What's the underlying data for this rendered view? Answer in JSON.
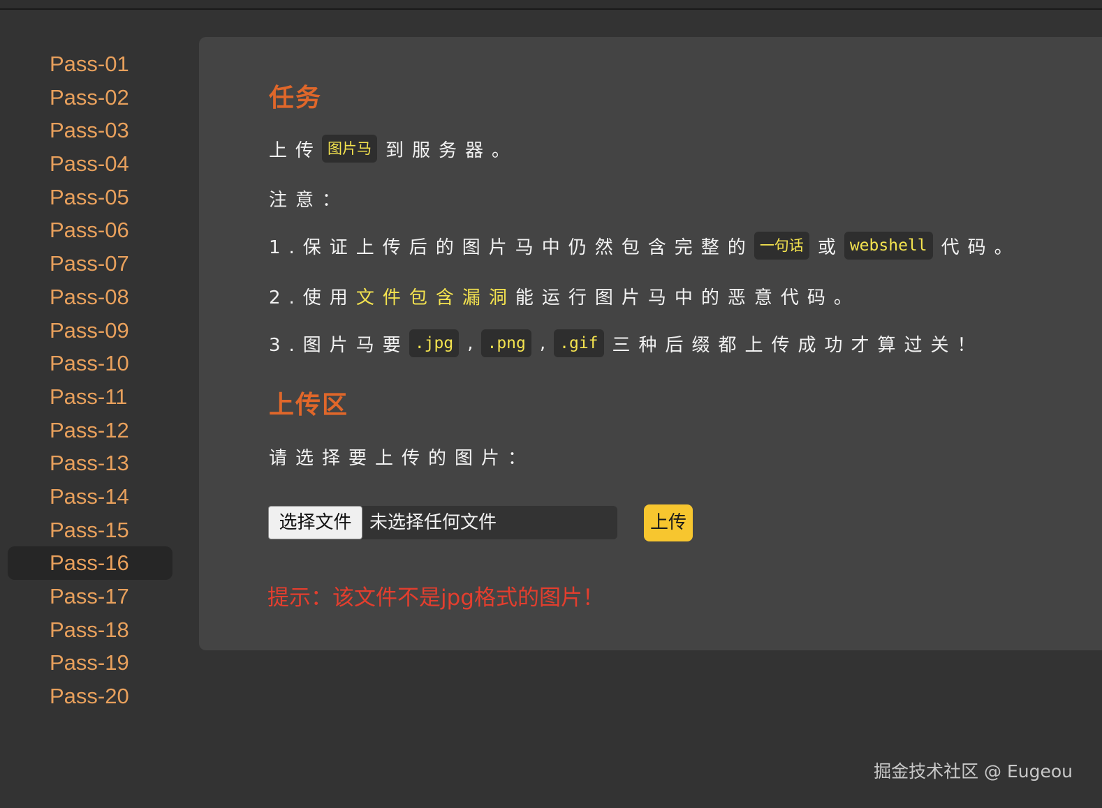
{
  "sidebar": {
    "items": [
      {
        "label": "Pass-01"
      },
      {
        "label": "Pass-02"
      },
      {
        "label": "Pass-03"
      },
      {
        "label": "Pass-04"
      },
      {
        "label": "Pass-05"
      },
      {
        "label": "Pass-06"
      },
      {
        "label": "Pass-07"
      },
      {
        "label": "Pass-08"
      },
      {
        "label": "Pass-09"
      },
      {
        "label": "Pass-10"
      },
      {
        "label": "Pass-11"
      },
      {
        "label": "Pass-12"
      },
      {
        "label": "Pass-13"
      },
      {
        "label": "Pass-14"
      },
      {
        "label": "Pass-15"
      },
      {
        "label": "Pass-16"
      },
      {
        "label": "Pass-17"
      },
      {
        "label": "Pass-18"
      },
      {
        "label": "Pass-19"
      },
      {
        "label": "Pass-20"
      }
    ],
    "active_index": 15
  },
  "task": {
    "title": "任务",
    "line1": {
      "before": "上传",
      "code": "图片马",
      "after": "到服务器。"
    },
    "note_label": "注意：",
    "item1": {
      "before": "1.保证上传后的图片马中仍然包含完整的",
      "code1": "一句话",
      "middle": "或",
      "code2": "webshell",
      "after": "代码。"
    },
    "item2": {
      "before": "2.使用",
      "highlight": "文件包含漏洞",
      "after": "能运行图片马中的恶意代码。"
    },
    "item3": {
      "before": "3.图片马要",
      "ext1": ".jpg",
      "sep1": ",",
      "ext2": ".png",
      "sep2": ",",
      "ext3": ".gif",
      "after": "三种后缀都上传成功才算过关！"
    }
  },
  "upload": {
    "title": "上传区",
    "prompt": "请选择要上传的图片：",
    "file_button_label": "选择文件",
    "file_status": "未选择任何文件",
    "submit_label": "上传",
    "hint": "提示：该文件不是jpg格式的图片！"
  },
  "watermark": "掘金技术社区 @ Eugeou",
  "colors": {
    "page_bg": "#333333",
    "panel_bg": "#444444",
    "sidebar_link": "#e8a05c",
    "heading": "#e0672a",
    "code_text": "#f4e34f",
    "button_accent": "#f7c62f",
    "error_text": "#e33e2e"
  }
}
